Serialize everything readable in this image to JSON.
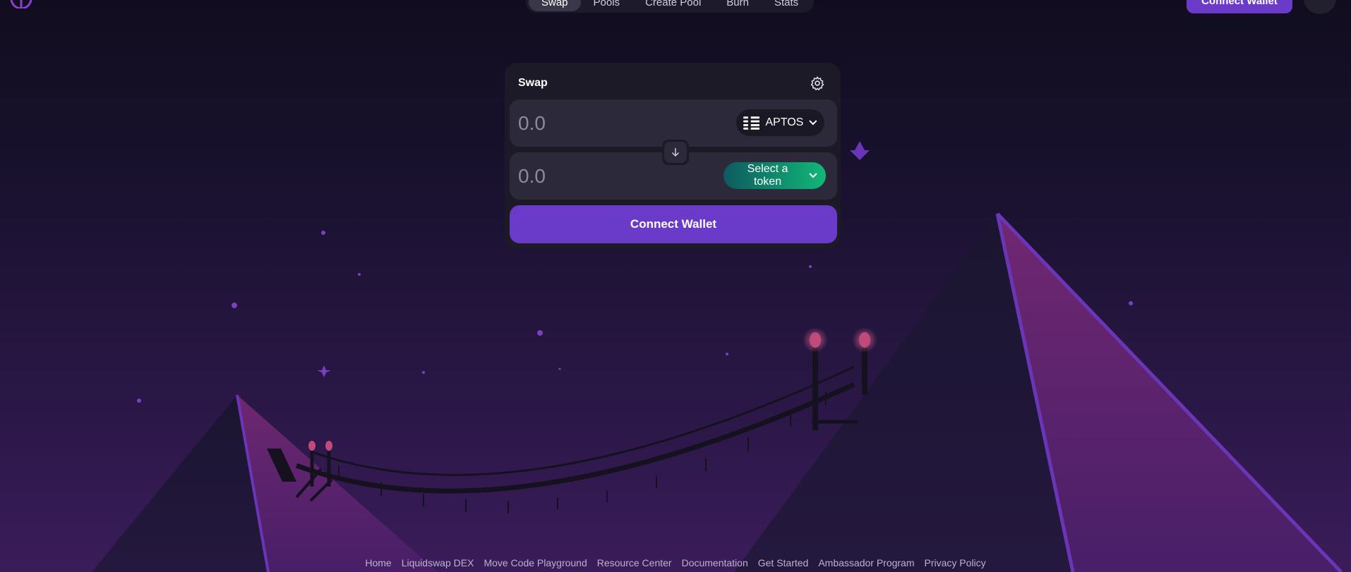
{
  "nav": {
    "items": [
      {
        "label": "Swap",
        "active": true
      },
      {
        "label": "Pools",
        "active": false
      },
      {
        "label": "Create Pool",
        "active": false
      },
      {
        "label": "Burn",
        "active": false
      },
      {
        "label": "Stats",
        "active": false
      }
    ],
    "connect_label": "Connect Wallet"
  },
  "swap": {
    "title": "Swap",
    "from": {
      "placeholder": "0.0",
      "token": "APTOS",
      "token_icon": "aptos-icon"
    },
    "to": {
      "placeholder": "0.0",
      "token": "Select a token"
    },
    "connect_label": "Connect Wallet"
  },
  "footer": {
    "links": [
      "Home",
      "Liquidswap DEX",
      "Move Code Playground",
      "Resource Center",
      "Documentation",
      "Get Started",
      "Ambassador Program",
      "Privacy Policy"
    ]
  },
  "colors": {
    "accent": "#6a3bc8",
    "card": "#1c1a27",
    "field": "#2c2a3a",
    "select_gradient_start": "#0f5a5f",
    "select_gradient_end": "#11b878"
  }
}
